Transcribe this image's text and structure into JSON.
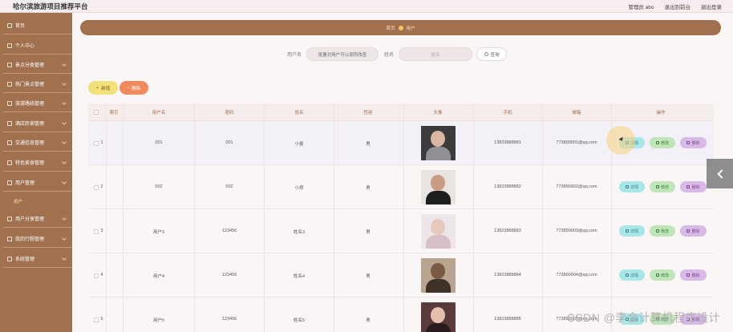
{
  "app": {
    "title": "哈尔滨旅游项目推荐平台"
  },
  "top_links": [
    "管理员 abo",
    "退出到前台",
    "退出登录"
  ],
  "sidebar": {
    "items": [
      {
        "label": "首页",
        "chevron": false
      },
      {
        "label": "个人中心",
        "chevron": false
      },
      {
        "label": "景点分类管理",
        "chevron": true
      },
      {
        "label": "热门景点管理",
        "chevron": true
      },
      {
        "label": "旅游路线管理",
        "chevron": true
      },
      {
        "label": "酒店民宿管理",
        "chevron": true
      },
      {
        "label": "交通信息管理",
        "chevron": true
      },
      {
        "label": "特色美食管理",
        "chevron": true
      },
      {
        "label": "用户管理",
        "chevron": true
      },
      {
        "label": "用户分享管理",
        "chevron": true
      },
      {
        "label": "我的行程管理",
        "chevron": true
      },
      {
        "label": "系统管理",
        "chevron": true
      }
    ],
    "active_sub": "用户"
  },
  "breadcrumb": [
    "首页",
    "用户"
  ],
  "search": {
    "label_username": "用户名",
    "username_value": "批量对用户可以调剂改查",
    "label_name": "姓名",
    "name_placeholder": "姓名",
    "search_button": "查询"
  },
  "actions": {
    "add": "新增",
    "delete": "删除"
  },
  "table": {
    "columns": [
      "索引",
      "用户名",
      "密码",
      "姓名",
      "性别",
      "头像",
      "手机",
      "邮箱",
      "操作"
    ],
    "rows": [
      {
        "index": "1",
        "username": "001",
        "password": "001",
        "name": "小曼",
        "gender": "男",
        "phone": "13823888881",
        "email": "773890001@qq.com"
      },
      {
        "index": "2",
        "username": "002",
        "password": "002",
        "name": "小郑",
        "gender": "男",
        "phone": "13823888882",
        "email": "773890002@qq.com"
      },
      {
        "index": "3",
        "username": "用户3",
        "password": "123456",
        "name": "姓名3",
        "gender": "男",
        "phone": "13823888883",
        "email": "773890003@qq.com"
      },
      {
        "index": "4",
        "username": "用户4",
        "password": "123456",
        "name": "姓名4",
        "gender": "男",
        "phone": "13823888884",
        "email": "773890004@qq.com"
      },
      {
        "index": "5",
        "username": "用户5",
        "password": "123456",
        "name": "姓名5",
        "gender": "男",
        "phone": "13823888885",
        "email": "773890005@qq.com"
      }
    ],
    "row_actions": {
      "detail": "详情",
      "edit": "修改",
      "delete": "删除"
    }
  },
  "watermark": "CSDN @李会计算机程序设计",
  "colors": {
    "sidebar": "#a1714f",
    "accent_yellow": "#f3e07b",
    "accent_orange": "#f08a5c"
  }
}
